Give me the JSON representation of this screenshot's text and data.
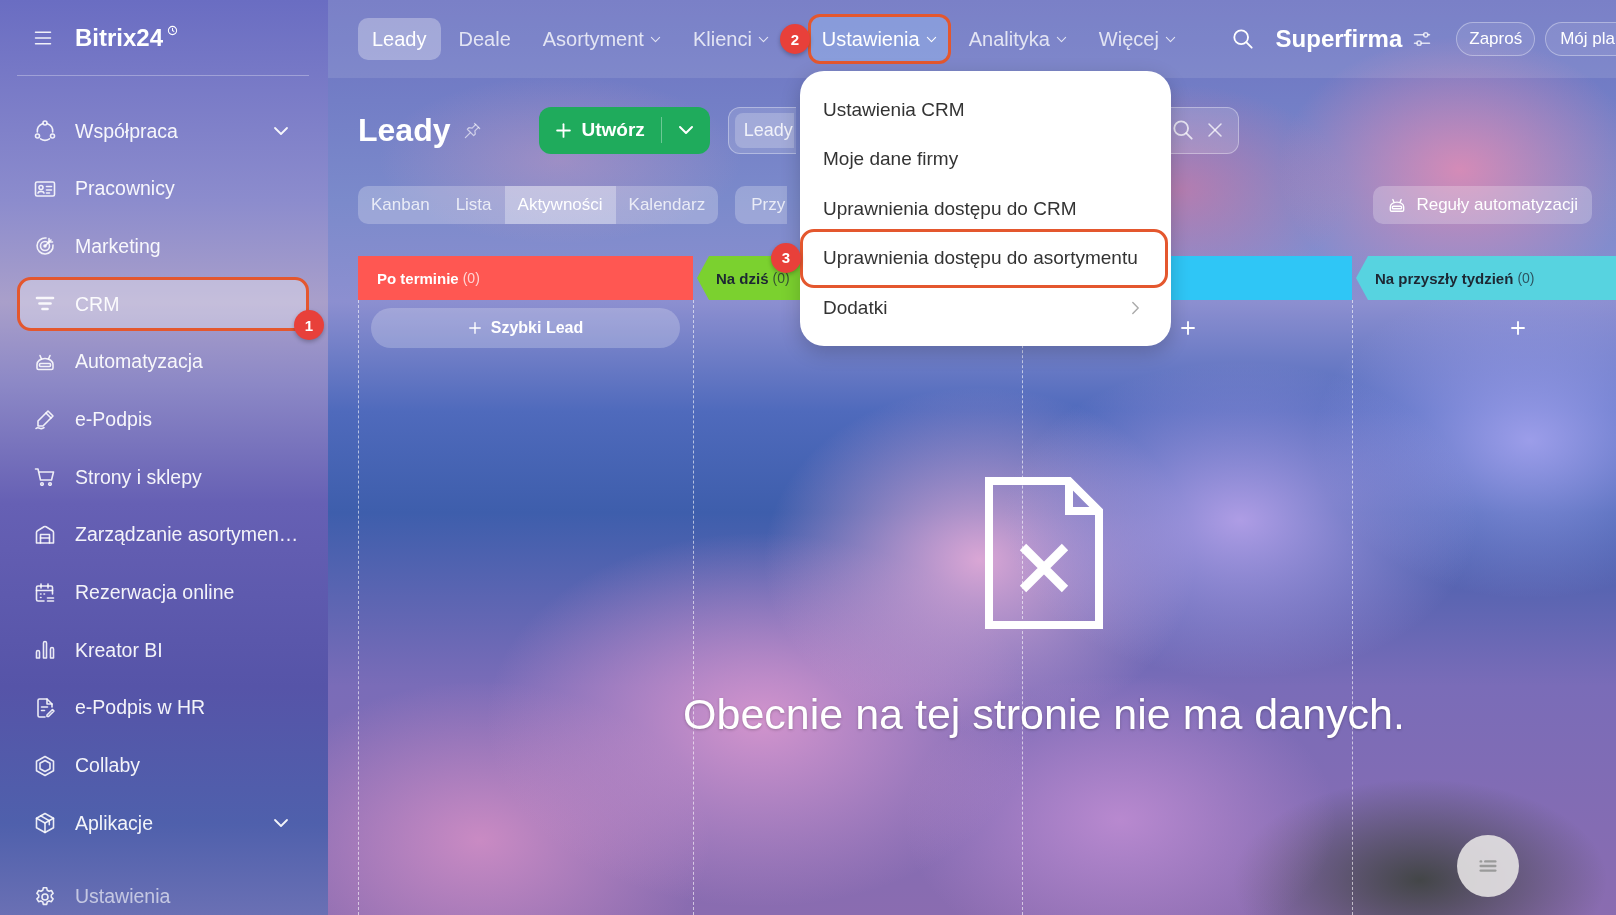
{
  "sidebar": {
    "logo": "Bitrix24",
    "items": [
      {
        "label": "Współpraca",
        "kind": "group",
        "selected": false
      },
      {
        "label": "Pracownicy",
        "kind": "link",
        "selected": false
      },
      {
        "label": "Marketing",
        "kind": "link",
        "selected": false
      },
      {
        "label": "CRM",
        "kind": "link",
        "selected": true,
        "callout": "1"
      },
      {
        "label": "Automatyzacja",
        "kind": "link",
        "selected": false
      },
      {
        "label": "e-Podpis",
        "kind": "link",
        "selected": false
      },
      {
        "label": "Strony i sklepy",
        "kind": "link",
        "selected": false
      },
      {
        "label": "Zarządzanie asortymen…",
        "kind": "link",
        "selected": false
      },
      {
        "label": "Rezerwacja online",
        "kind": "link",
        "selected": false
      },
      {
        "label": "Kreator BI",
        "kind": "link",
        "selected": false
      },
      {
        "label": "e-Podpis w HR",
        "kind": "link",
        "selected": false
      },
      {
        "label": "Collaby",
        "kind": "link",
        "selected": false
      },
      {
        "label": "Aplikacje",
        "kind": "group",
        "selected": false
      }
    ],
    "footer_item": {
      "label": "Ustawienia"
    }
  },
  "top_nav": {
    "tabs": [
      {
        "label": "Leady",
        "kind": "link",
        "selected": true,
        "expanded": false
      },
      {
        "label": "Deale",
        "kind": "link",
        "selected": false,
        "expanded": false
      },
      {
        "label": "Asortyment",
        "kind": "menu",
        "selected": false,
        "expanded": false
      },
      {
        "label": "Klienci",
        "kind": "menu",
        "selected": false,
        "expanded": false
      },
      {
        "label": "Ustawienia",
        "kind": "menu",
        "selected": false,
        "expanded": true,
        "callout": "2"
      },
      {
        "label": "Analityka",
        "kind": "menu",
        "selected": false,
        "expanded": false
      },
      {
        "label": "Więcej",
        "kind": "menu",
        "selected": false,
        "expanded": false
      }
    ],
    "company": "Superfirma",
    "buttons": [
      {
        "label": "Zaproś"
      },
      {
        "label": "Mój pla"
      }
    ]
  },
  "page_header": {
    "title": "Leady",
    "create_button": "Utwórz",
    "filter": {
      "chip": "Leady"
    },
    "views": [
      {
        "label": "Kanban",
        "selected": false
      },
      {
        "label": "Lista",
        "selected": false
      },
      {
        "label": "Aktywności",
        "selected": true
      },
      {
        "label": "Kalendarz",
        "selected": false
      }
    ],
    "extra_button": "Przy",
    "automation_button": "Reguły automatyzacji"
  },
  "kanban": {
    "columns": [
      {
        "title": "Po terminie",
        "count": "(0)",
        "color": "#ff5752",
        "quick_add": "Szybki Lead"
      },
      {
        "title": "Na dziś",
        "count": "(0)",
        "color": "#7bd12f"
      },
      {
        "color": "#2fc6f6",
        "add_button": true
      },
      {
        "title": "Na przyszły tydzień",
        "count": "(0)",
        "color": "#57d3e0",
        "add_button": true
      }
    ],
    "empty_message": "Obecnie na tej stronie nie ma danych."
  },
  "dropdown": {
    "items": [
      {
        "label": "Ustawienia CRM"
      },
      {
        "label": "Moje dane firmy"
      },
      {
        "label": "Uprawnienia dostępu do CRM"
      },
      {
        "label": "Uprawnienia dostępu do asortymentu",
        "callout": "3"
      },
      {
        "label": "Dodatki",
        "submenu": true
      }
    ]
  }
}
